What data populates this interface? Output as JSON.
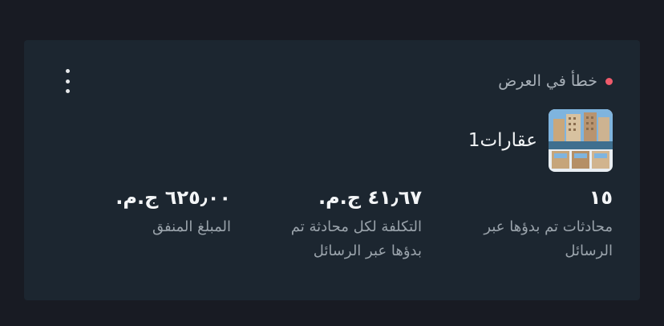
{
  "card": {
    "status_text": "خطأ في العرض",
    "status_color": "#ef5b6b",
    "menu_icon": "more-vertical-icon",
    "ad_name": "عقارات1",
    "metrics": [
      {
        "value": "١٥",
        "label": "محادثات تم بدؤها عبر الرسائل"
      },
      {
        "value": "٤١٫٦٧ ج.م.",
        "label": "التكلفة لكل محادثة تم بدؤها عبر الرسائل"
      },
      {
        "value": "٦٢٥٫٠٠ ج.م.",
        "label": "المبلغ المنفق"
      }
    ]
  }
}
